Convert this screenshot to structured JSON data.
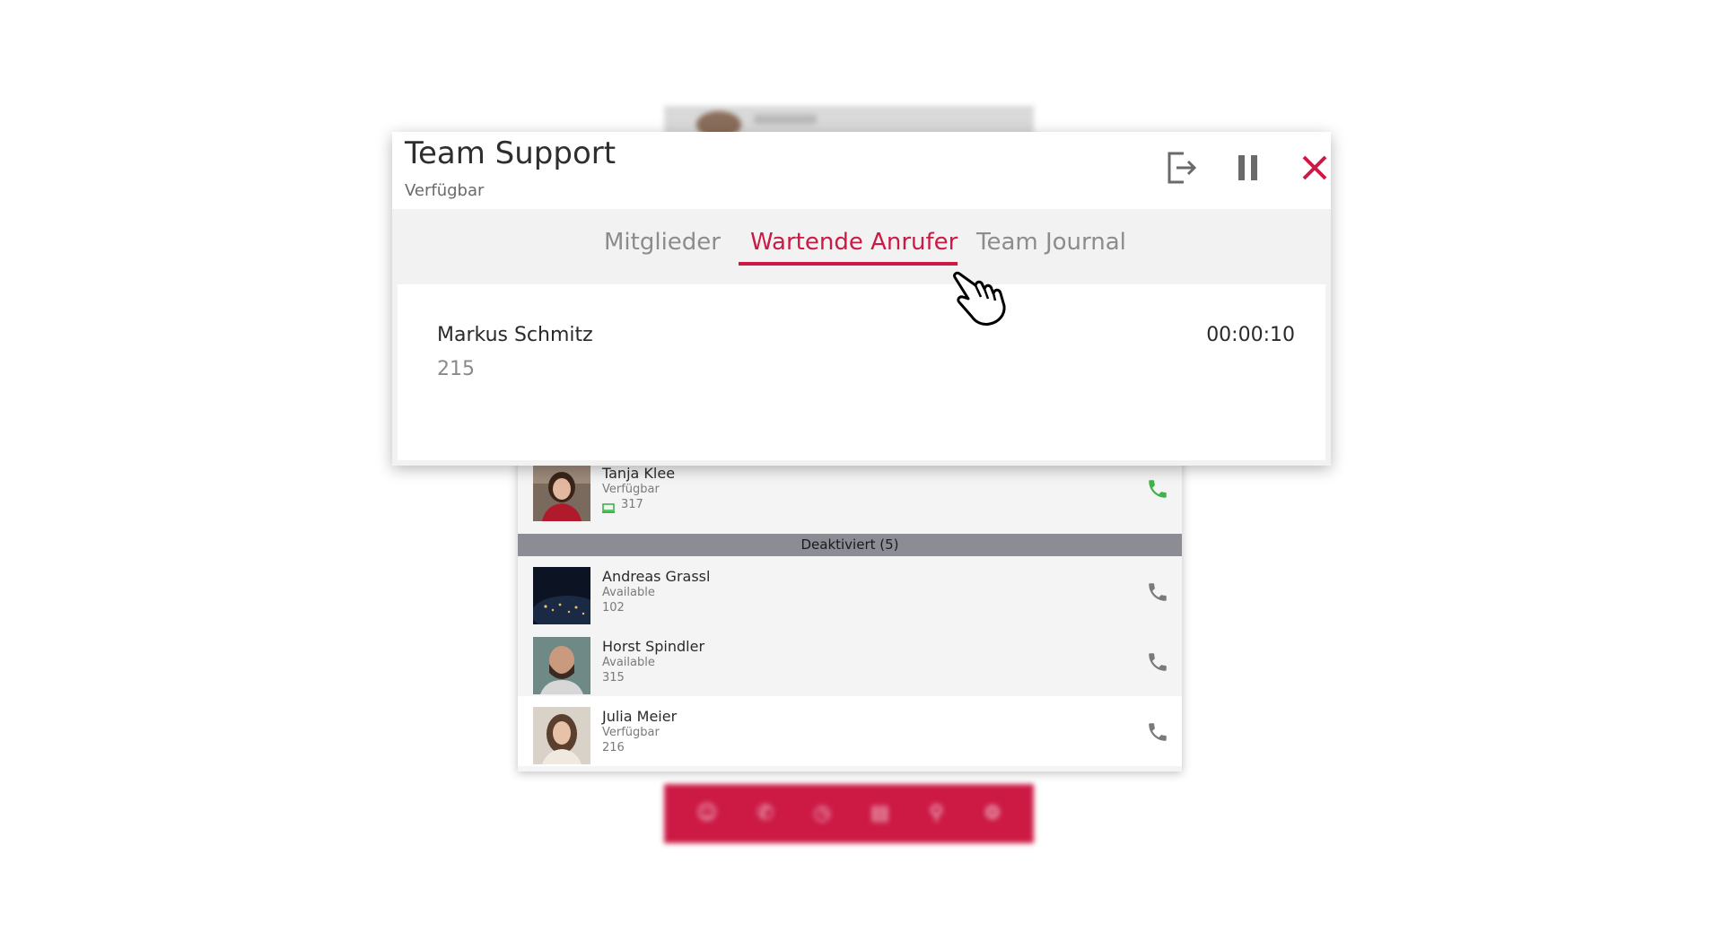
{
  "colors": {
    "accent": "#cc1a45",
    "call_active": "#3cb44b",
    "call_inactive": "#7a7a7a",
    "section_header_bg": "#8c8c94"
  },
  "dialog": {
    "title": "Team Support",
    "status": "Verfügbar",
    "header_icons": [
      "leave-team-icon",
      "pause-icon",
      "close-icon"
    ],
    "tabs": [
      {
        "label": "Mitglieder",
        "active": false
      },
      {
        "label": "Wartende Anrufer",
        "active": true
      },
      {
        "label": "Team Journal",
        "active": false
      }
    ],
    "waiting_callers": [
      {
        "name": "Markus Schmitz",
        "extension": "215",
        "wait_time": "00:00:10"
      }
    ]
  },
  "members": {
    "active": [
      {
        "name": "Tanja Klee",
        "status": "Verfügbar",
        "extension": "317",
        "device_icon": "computer-icon",
        "call_icon": "phone-icon",
        "call_state": "active"
      }
    ],
    "deactivated_header": "Deaktiviert (5)",
    "deactivated": [
      {
        "name": "Andreas Grassl",
        "status": "Available",
        "extension": "102",
        "call_icon": "phone-icon",
        "call_state": "inactive"
      },
      {
        "name": "Horst Spindler",
        "status": "Available",
        "extension": "315",
        "call_icon": "phone-icon",
        "call_state": "inactive"
      },
      {
        "name": "Julia Meier",
        "status": "Verfügbar",
        "extension": "216",
        "call_icon": "phone-icon",
        "call_state": "inactive"
      }
    ]
  },
  "background_nav_icons": [
    "team-icon",
    "phone-icon",
    "history-icon",
    "contacts-icon",
    "search-icon",
    "settings-icon"
  ]
}
